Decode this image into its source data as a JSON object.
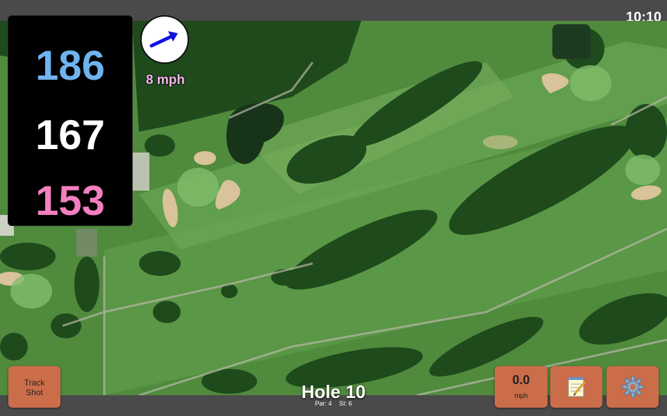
{
  "status_bar": {
    "time": "10:10"
  },
  "distances": {
    "back": "186",
    "middle": "167",
    "front": "153"
  },
  "wind": {
    "speed_label": "8 mph",
    "direction_icon": "wind-arrow-icon"
  },
  "hole": {
    "title": "Hole 10",
    "par": "Par: 4",
    "stroke_index": "SI: 6"
  },
  "buttons": {
    "track_shot_line1": "Track",
    "track_shot_line2": "Shot",
    "wind_value": "0.0",
    "wind_unit": "mph",
    "notes_icon": "notepad-icon",
    "settings_icon": "gear-icon"
  },
  "colors": {
    "back_distance": "#6fb3f0",
    "middle_distance": "#ffffff",
    "front_distance": "#f47fbf",
    "button": "#cb6d49",
    "wind_arrow": "#1010e0"
  }
}
